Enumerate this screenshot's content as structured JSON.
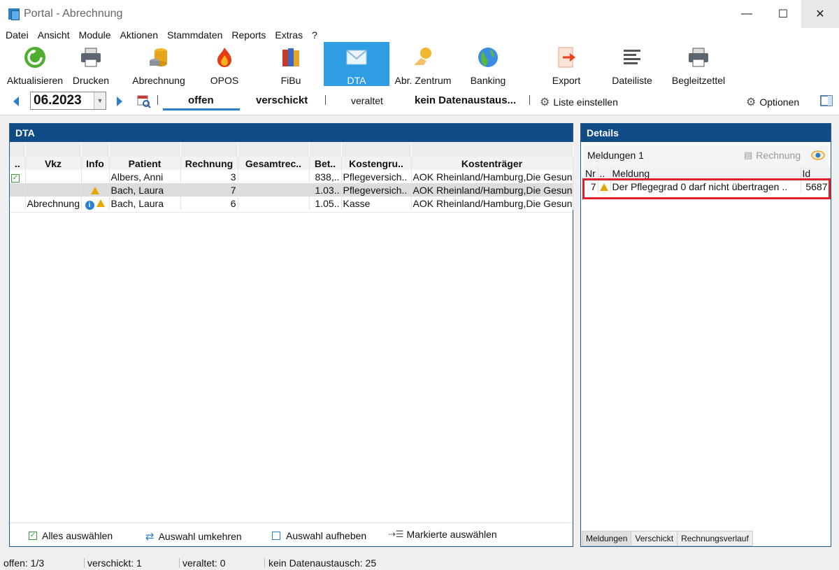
{
  "window": {
    "title": "Portal - Abrechnung"
  },
  "menu": [
    "Datei",
    "Ansicht",
    "Module",
    "Aktionen",
    "Stammdaten",
    "Reports",
    "Extras",
    "?"
  ],
  "toolbar": {
    "refresh": "Aktualisieren",
    "print": "Drucken",
    "billing": "Abrechnung",
    "opos": "OPOS",
    "fibu": "FiBu",
    "dta": "DTA",
    "center": "Abr. Zentrum",
    "banking": "Banking",
    "export": "Export",
    "filelist": "Dateiliste",
    "slip": "Begleitzettel"
  },
  "filter": {
    "period": "06.2023",
    "tabs": [
      "offen",
      "verschickt",
      "veraltet",
      "kein Datenaustaus..."
    ],
    "active_tab": "offen",
    "list_settings": "Liste einstellen",
    "options": "Optionen"
  },
  "dta": {
    "title": "DTA",
    "columns": [
      "..",
      "Vkz",
      "Info",
      "Patient",
      "Rechnung",
      "Gesamtrec..",
      "Bet..",
      "Kostengru..",
      "Kostenträger"
    ],
    "rows": [
      {
        "vkz": "",
        "patient": "Albers, Anni",
        "rechnung": "3",
        "gesamt": "",
        "betrag": "838,..",
        "kostengruppe": "Pflegeversich..",
        "kostentraeger": "AOK Rheinland/Hamburg,Die Gesun"
      },
      {
        "vkz": "",
        "patient": "Bach, Laura",
        "rechnung": "7",
        "gesamt": "",
        "betrag": "1.03..",
        "kostengruppe": "Pflegeversich..",
        "kostentraeger": "AOK Rheinland/Hamburg,Die Gesun"
      },
      {
        "vkz": "Abrechnung",
        "patient": "Bach, Laura",
        "rechnung": "6",
        "gesamt": "",
        "betrag": "1.05..",
        "kostengruppe": "Kasse",
        "kostentraeger": "AOK Rheinland/Hamburg,Die Gesun"
      }
    ],
    "actions": {
      "select_all": "Alles auswählen",
      "invert": "Auswahl umkehren",
      "clear": "Auswahl aufheben",
      "select_marked": "Markierte auswählen"
    }
  },
  "details": {
    "title": "Details",
    "messages_label": "Meldungen 1",
    "invoice_button": "Rechnung",
    "columns": [
      "Nr",
      "..",
      "Meldung",
      "Id"
    ],
    "rows": [
      {
        "nr": "7",
        "meldung": "Der Pflegegrad 0 darf nicht übertragen ..",
        "id": "5687"
      }
    ],
    "tabs": [
      "Meldungen",
      "Verschickt",
      "Rechnungsverlauf"
    ]
  },
  "status": {
    "offen": "offen: 1/3",
    "verschickt": "verschickt: 1",
    "veraltet": "veraltet: 0",
    "kein": "kein Datenaustausch: 25"
  },
  "colors": {
    "accent": "#2f9de4",
    "panel_header": "#0f4c86",
    "highlight": "#e0202a"
  }
}
